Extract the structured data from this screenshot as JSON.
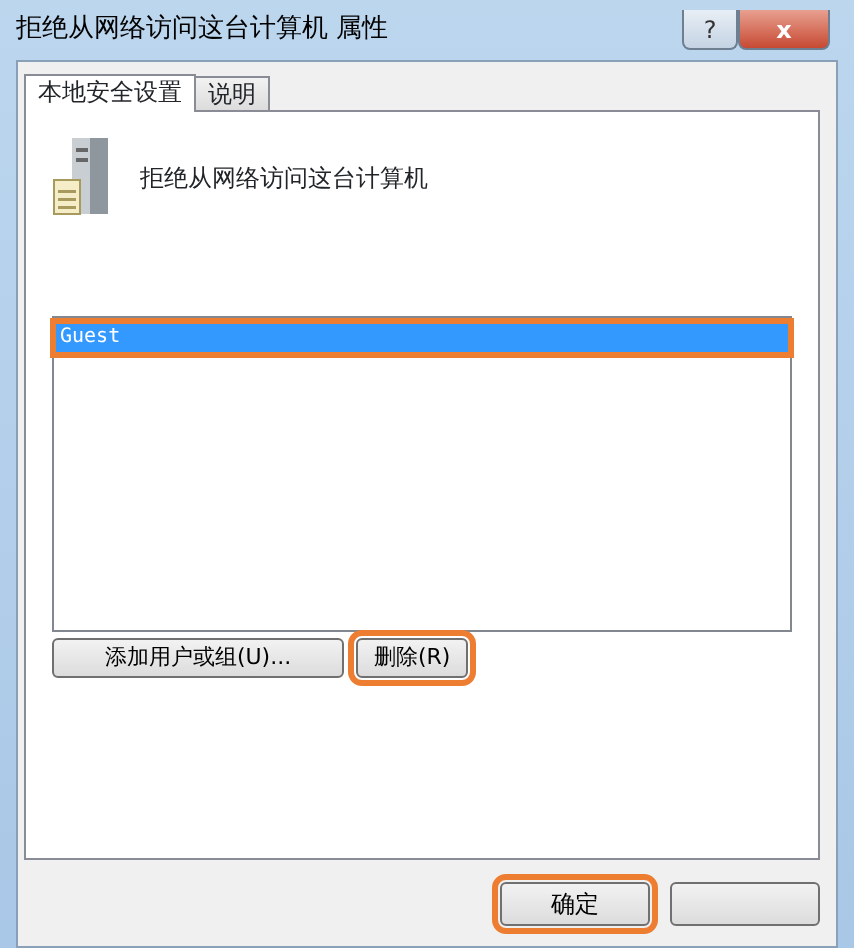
{
  "window": {
    "title": "拒绝从网络访问这台计算机 属性",
    "help_button": "?",
    "close_button": "x"
  },
  "tabs": [
    {
      "label": "本地安全设置",
      "selected": true
    },
    {
      "label": "说明",
      "selected": false
    }
  ],
  "policy": {
    "name": "拒绝从网络访问这台计算机"
  },
  "accounts": [
    {
      "name": "Guest",
      "selected": true,
      "highlighted": true
    }
  ],
  "actions": [
    {
      "label": "添加用户或组(U)...",
      "highlighted": false
    },
    {
      "label": "删除(R)",
      "highlighted": true
    }
  ],
  "footer_buttons": [
    {
      "label": "确定",
      "highlighted": true
    },
    {
      "highlighted": false
    }
  ]
}
